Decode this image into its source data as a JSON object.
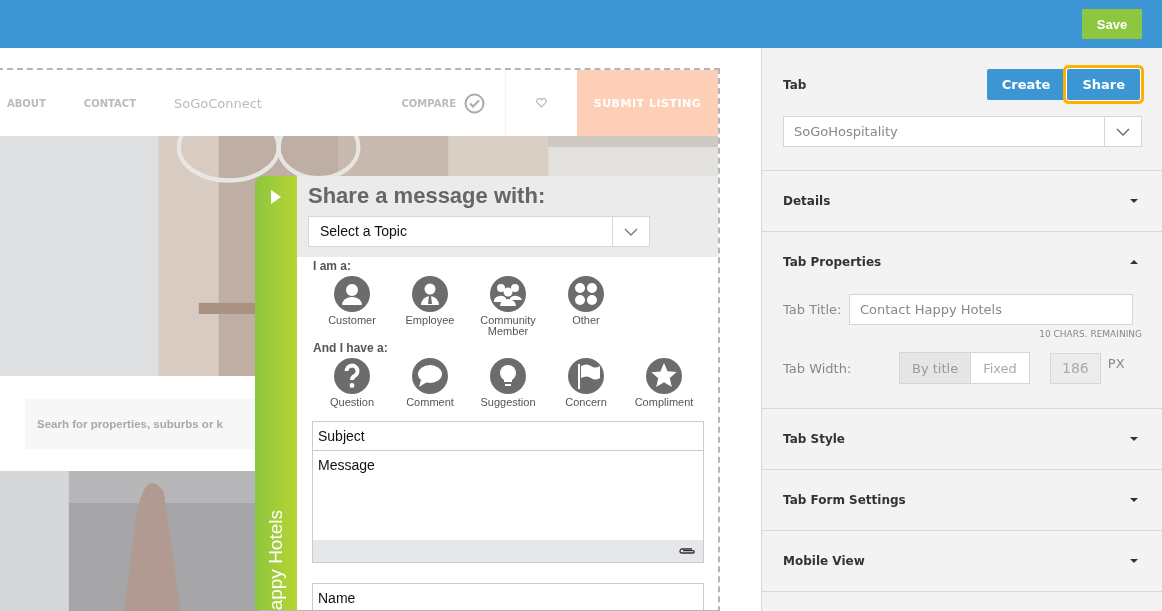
{
  "top_bar": {
    "save_button": "Save"
  },
  "preview": {
    "nav": {
      "links": [
        "ABOUT",
        "CONTACT",
        "SoGoConnect"
      ],
      "compare": "COMPARE",
      "submit_button": "SUBMIT LISTING"
    },
    "search": {
      "placeholder": "Searh for properties, suburbs or k"
    },
    "widget": {
      "tab_label": "appy Hotels",
      "heading": "Share a message with:",
      "topic_select": {
        "value": "Select a Topic"
      },
      "roles": {
        "label": "I am a:",
        "options": [
          {
            "label": "Customer",
            "kind": "customer"
          },
          {
            "label": "Employee",
            "kind": "employee"
          },
          {
            "label": "Community Member",
            "kind": "community"
          },
          {
            "label": "Other",
            "kind": "other"
          }
        ]
      },
      "feedback_types": {
        "label": "And I have a:",
        "options": [
          {
            "label": "Question",
            "kind": "question"
          },
          {
            "label": "Comment",
            "kind": "comment"
          },
          {
            "label": "Suggestion",
            "kind": "suggestion"
          },
          {
            "label": "Concern",
            "kind": "concern"
          },
          {
            "label": "Compliment",
            "kind": "compliment"
          }
        ]
      },
      "fields": [
        {
          "kind": "input",
          "placeholder": "Subject"
        },
        {
          "kind": "textarea",
          "placeholder": "Message"
        },
        {
          "kind": "input",
          "placeholder": "Name"
        }
      ]
    }
  },
  "panel": {
    "tab": {
      "label": "Tab",
      "buttons": [
        {
          "label": "Create",
          "highlighted": false
        },
        {
          "label": "Share",
          "highlighted": true
        }
      ],
      "select": {
        "value": "SoGoHospitality"
      }
    },
    "sections": [
      {
        "title": "Details",
        "expanded": false
      },
      {
        "title": "Tab Properties",
        "expanded": true,
        "title_field": {
          "label": "Tab Title:",
          "value": "Contact Happy Hotels",
          "hint": "10 CHARS. REMAINING"
        },
        "width": {
          "label": "Tab Width:",
          "options": [
            {
              "label": "By title",
              "selected": true
            },
            {
              "label": "Fixed",
              "selected": false
            }
          ],
          "value": "186",
          "unit": "PX",
          "disabled": true
        }
      },
      {
        "title": "Tab Style",
        "expanded": false
      },
      {
        "title": "Tab Form Settings",
        "expanded": false
      },
      {
        "title": "Mobile View",
        "expanded": false
      }
    ]
  }
}
